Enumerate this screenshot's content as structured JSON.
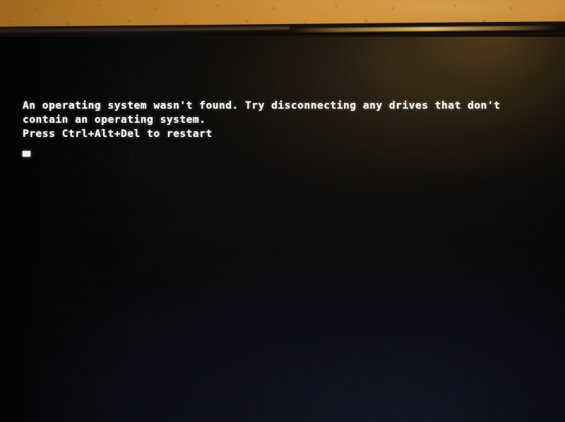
{
  "scene": {
    "description": "Photograph of a computer monitor showing a firmware boot error",
    "wall_color": "#bd7f2a",
    "bezel_color": "#120d0a",
    "screen_color": "#08080a",
    "glow_color": "#c48e40",
    "cool_cast_color": "#282e52"
  },
  "screen": {
    "type": "bios-boot-error",
    "text_color": "#f4f4f2",
    "background_color": "#000000",
    "lines": [
      "An operating system wasn't found. Try disconnecting any drives that don't",
      "contain an operating system.",
      "Press Ctrl+Alt+Del to restart"
    ],
    "cursor": {
      "visible": true,
      "glyph": "_",
      "style": "block"
    }
  }
}
